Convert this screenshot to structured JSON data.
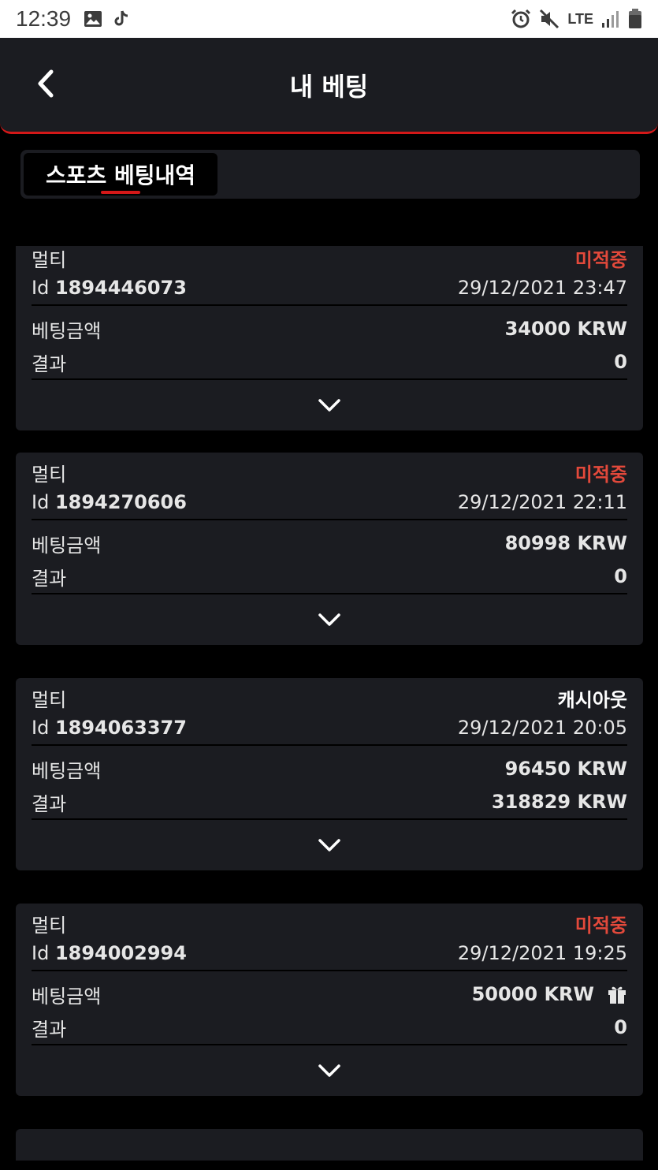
{
  "statusbar": {
    "time": "12:39",
    "network": "LTE"
  },
  "header": {
    "title": "내 베팅"
  },
  "tabs": [
    {
      "label": "스포츠 베팅내역"
    }
  ],
  "bets": [
    {
      "type": "멀티",
      "status": "미적중",
      "status_color": "#e3493b",
      "id_label": "Id",
      "id": "1894446073",
      "datetime": "29/12/2021 23:47",
      "stake_label": "베팅금액",
      "stake": "34000 KRW",
      "result_label": "결과",
      "result": "0",
      "gift": false
    },
    {
      "type": "멀티",
      "status": "미적중",
      "status_color": "#e3493b",
      "id_label": "Id",
      "id": "1894270606",
      "datetime": "29/12/2021 22:11",
      "stake_label": "베팅금액",
      "stake": "80998 KRW",
      "result_label": "결과",
      "result": "0",
      "gift": false
    },
    {
      "type": "멀티",
      "status": "캐시아웃",
      "status_color": "#ffffff",
      "id_label": "Id",
      "id": "1894063377",
      "datetime": "29/12/2021 20:05",
      "stake_label": "베팅금액",
      "stake": "96450 KRW",
      "result_label": "결과",
      "result": "318829 KRW",
      "gift": false
    },
    {
      "type": "멀티",
      "status": "미적중",
      "status_color": "#e3493b",
      "id_label": "Id",
      "id": "1894002994",
      "datetime": "29/12/2021 19:25",
      "stake_label": "베팅금액",
      "stake": "50000 KRW",
      "result_label": "결과",
      "result": "0",
      "gift": true
    }
  ],
  "icons": {
    "back": "chevron-left-icon",
    "expand": "chevron-down-icon",
    "gift": "gift-icon"
  }
}
